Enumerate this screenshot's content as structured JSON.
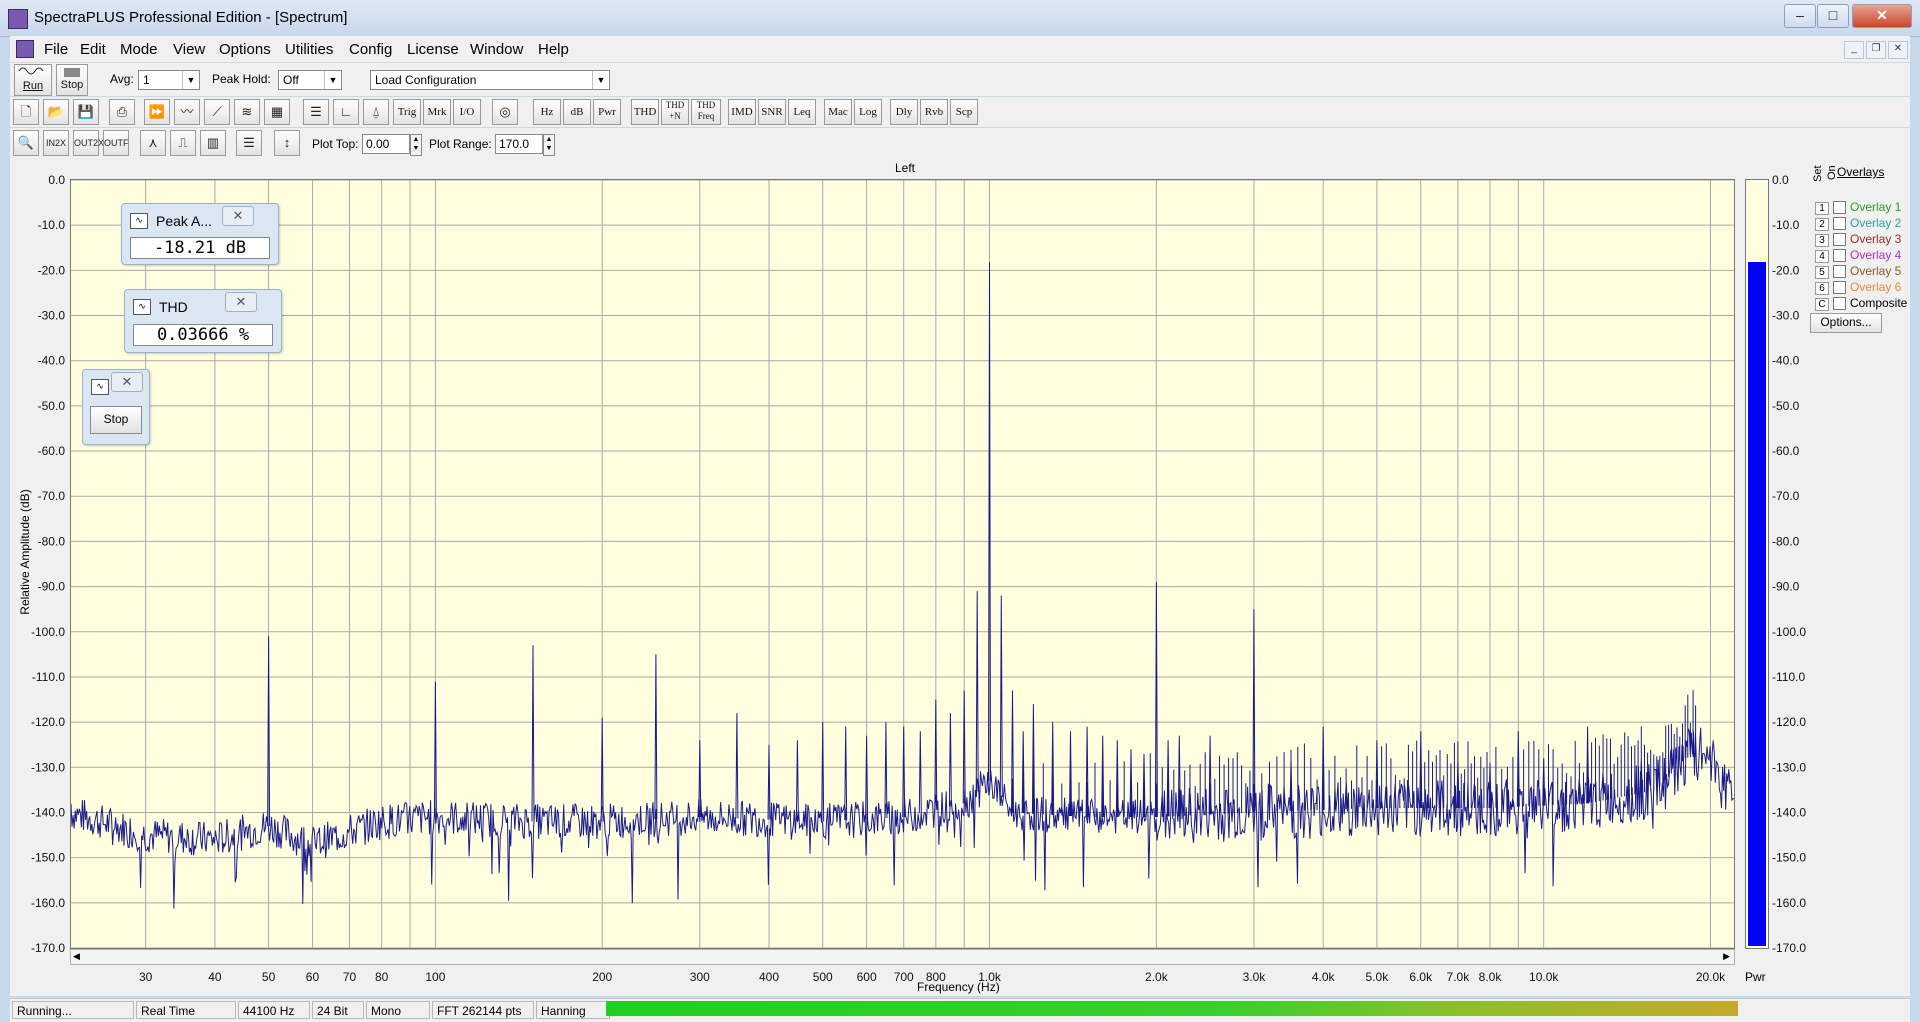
{
  "window": {
    "title": "SpectraPLUS Professional Edition - [Spectrum]"
  },
  "menu": [
    "File",
    "Edit",
    "Mode",
    "View",
    "Options",
    "Utilities",
    "Config",
    "License",
    "Window",
    "Help"
  ],
  "toolbar1": {
    "run_label": "Run",
    "stop_label": "Stop",
    "avg_label": "Avg:",
    "avg_value": "1",
    "peak_hold_label": "Peak Hold:",
    "peak_hold_value": "Off",
    "config_value": "Load Configuration"
  },
  "toolbar2": {
    "text_buttons": [
      "Trig",
      "Mrk",
      "I/O",
      "Hz",
      "dB",
      "Pwr",
      "THD",
      "THD +N",
      "THD Freq",
      "IMD",
      "SNR",
      "Leq",
      "Mac",
      "Log",
      "Dly",
      "Rvb",
      "Scp"
    ]
  },
  "toolbar3": {
    "plot_top_label": "Plot Top:",
    "plot_top_value": "0.00",
    "plot_range_label": "Plot Range:",
    "plot_range_value": "170.0"
  },
  "widgets": {
    "peak": {
      "title": "Peak A...",
      "value": "-18.21 dB"
    },
    "thd": {
      "title": "THD",
      "value": "0.03666 %"
    },
    "stop": {
      "button_label": "Stop"
    }
  },
  "overlays": {
    "header": "Overlays",
    "set_label": "Set",
    "on_label": "On",
    "items": [
      {
        "key": "1",
        "label": "Overlay 1",
        "color": "#2a9a2a"
      },
      {
        "key": "2",
        "label": "Overlay 2",
        "color": "#2aa0a0"
      },
      {
        "key": "3",
        "label": "Overlay 3",
        "color": "#9a2a2a"
      },
      {
        "key": "4",
        "label": "Overlay 4",
        "color": "#c02ac0"
      },
      {
        "key": "5",
        "label": "Overlay 5",
        "color": "#8a5a2a"
      },
      {
        "key": "6",
        "label": "Overlay 6",
        "color": "#e08a3a"
      },
      {
        "key": "C",
        "label": "Composite",
        "color": "#000000"
      }
    ],
    "options_label": "Options..."
  },
  "meter": {
    "level_db": -18.21,
    "label": "Pwr"
  },
  "status": {
    "state": "Running...",
    "mode": "Real Time",
    "rate": "44100 Hz",
    "bits": "24 Bit",
    "channels": "Mono",
    "fft": "FFT 262144 pts",
    "window": "Hanning"
  },
  "chart_data": {
    "type": "line",
    "title": "Left",
    "xlabel": "Frequency (Hz)",
    "ylabel": "Relative Amplitude (dB)",
    "x_scale": "log",
    "xlim": [
      22,
      22050
    ],
    "ylim": [
      -170,
      0
    ],
    "grid": true,
    "series_color": "#1a1a8c",
    "x_ticks": [
      {
        "v": 30,
        "label": "30"
      },
      {
        "v": 40,
        "label": "40"
      },
      {
        "v": 50,
        "label": "50"
      },
      {
        "v": 60,
        "label": "60"
      },
      {
        "v": 70,
        "label": "70"
      },
      {
        "v": 80,
        "label": "80"
      },
      {
        "v": 100,
        "label": "100"
      },
      {
        "v": 200,
        "label": "200"
      },
      {
        "v": 300,
        "label": "300"
      },
      {
        "v": 400,
        "label": "400"
      },
      {
        "v": 500,
        "label": "500"
      },
      {
        "v": 600,
        "label": "600"
      },
      {
        "v": 700,
        "label": "700"
      },
      {
        "v": 800,
        "label": "800"
      },
      {
        "v": 1000,
        "label": "1.0k"
      },
      {
        "v": 2000,
        "label": "2.0k"
      },
      {
        "v": 3000,
        "label": "3.0k"
      },
      {
        "v": 4000,
        "label": "4.0k"
      },
      {
        "v": 5000,
        "label": "5.0k"
      },
      {
        "v": 6000,
        "label": "6.0k"
      },
      {
        "v": 7000,
        "label": "7.0k"
      },
      {
        "v": 8000,
        "label": "8.0k"
      },
      {
        "v": 10000,
        "label": "10.0k"
      },
      {
        "v": 20000,
        "label": "20.0k"
      }
    ],
    "y_ticks": [
      "0.0",
      "-10.0",
      "-20.0",
      "-30.0",
      "-40.0",
      "-50.0",
      "-60.0",
      "-70.0",
      "-80.0",
      "-90.0",
      "-100.0",
      "-110.0",
      "-120.0",
      "-130.0",
      "-140.0",
      "-150.0",
      "-160.0",
      "-170.0"
    ],
    "noise_floor": [
      [
        22,
        -140
      ],
      [
        30,
        -145
      ],
      [
        40,
        -146
      ],
      [
        50,
        -143
      ],
      [
        60,
        -147
      ],
      [
        80,
        -142
      ],
      [
        100,
        -141
      ],
      [
        150,
        -142
      ],
      [
        200,
        -142
      ],
      [
        300,
        -141
      ],
      [
        500,
        -142
      ],
      [
        700,
        -141
      ],
      [
        900,
        -138
      ],
      [
        1000,
        -133
      ],
      [
        1100,
        -140
      ],
      [
        1500,
        -141
      ],
      [
        2000,
        -141
      ],
      [
        3000,
        -140
      ],
      [
        5000,
        -139
      ],
      [
        8000,
        -139
      ],
      [
        12000,
        -138
      ],
      [
        16000,
        -135
      ],
      [
        18000,
        -128
      ],
      [
        20000,
        -127
      ],
      [
        22050,
        -138
      ]
    ],
    "peaks": [
      [
        50,
        -101
      ],
      [
        100,
        -111
      ],
      [
        150,
        -103
      ],
      [
        200,
        -119
      ],
      [
        250,
        -105
      ],
      [
        300,
        -124
      ],
      [
        350,
        -118
      ],
      [
        400,
        -125
      ],
      [
        450,
        -124
      ],
      [
        500,
        -120
      ],
      [
        550,
        -121
      ],
      [
        600,
        -123
      ],
      [
        650,
        -120
      ],
      [
        700,
        -121
      ],
      [
        750,
        -122
      ],
      [
        800,
        -115
      ],
      [
        850,
        -118
      ],
      [
        900,
        -113
      ],
      [
        950,
        -91
      ],
      [
        1000,
        -18.2
      ],
      [
        1050,
        -92
      ],
      [
        1100,
        -113
      ],
      [
        1150,
        -122
      ],
      [
        1200,
        -116
      ],
      [
        1300,
        -120
      ],
      [
        1400,
        -122
      ],
      [
        1500,
        -121
      ],
      [
        1600,
        -123
      ],
      [
        1700,
        -124
      ],
      [
        1800,
        -126
      ],
      [
        1900,
        -127
      ],
      [
        2000,
        -89
      ],
      [
        2100,
        -124
      ],
      [
        2200,
        -123
      ],
      [
        2500,
        -123
      ],
      [
        3000,
        -95
      ],
      [
        3500,
        -128
      ],
      [
        4000,
        -121
      ],
      [
        5000,
        -124
      ],
      [
        6000,
        -122
      ],
      [
        7000,
        -128
      ],
      [
        8000,
        -129
      ],
      [
        9000,
        -122
      ],
      [
        10000,
        -128
      ],
      [
        12000,
        -121
      ],
      [
        15000,
        -128
      ]
    ]
  }
}
